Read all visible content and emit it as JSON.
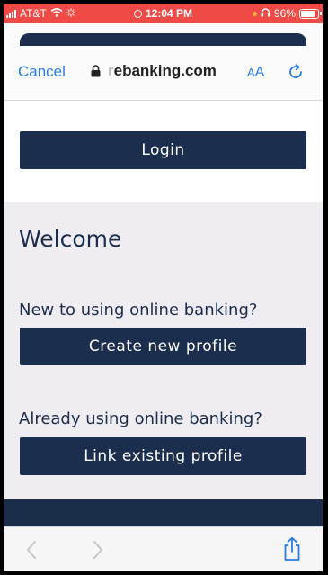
{
  "status_bar": {
    "carrier": "AT&T",
    "time": "12:04 PM",
    "battery_percent": "96%",
    "battery_level": 0.96,
    "background_color": "#ef4a46"
  },
  "browser": {
    "cancel_label": "Cancel",
    "url_prefix": "r",
    "url_main": "ebanking.com",
    "text_size_label_small": "A",
    "text_size_label_large": "A",
    "icons": [
      "lock-icon",
      "reload-icon",
      "back-icon",
      "forward-icon",
      "share-icon"
    ],
    "accent_color": "#2a7be3"
  },
  "page": {
    "login_label": "Login",
    "welcome_title": "Welcome",
    "new_prompt": "New to using online banking?",
    "create_label": "Create new profile",
    "existing_prompt": "Already using online banking?",
    "link_label": "Link existing profile",
    "brand_color": "#1c2e4d"
  }
}
